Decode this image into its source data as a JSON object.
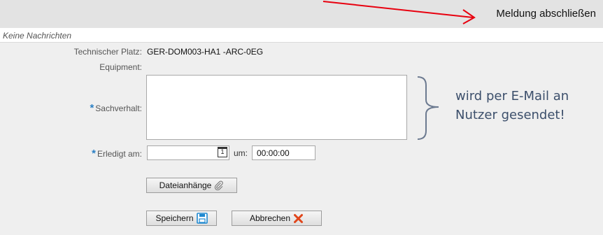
{
  "toolbar": {
    "action_label": "Meldung abschließen"
  },
  "messages": {
    "text": "Keine Nachrichten"
  },
  "form": {
    "tech_place_label": "Technischer Platz:",
    "tech_place_value": "GER-DOM003-HA1 -ARC-0EG",
    "equipment_label": "Equipment:",
    "required_marker": "*",
    "sachverhalt_label": "Sachverhalt:",
    "sachverhalt_value": "",
    "erledigt_label": "Erledigt am:",
    "date_value": "",
    "calendar_day": "1",
    "um_label": "um:",
    "time_value": "00:00:00"
  },
  "buttons": {
    "attachments": "Dateianhänge",
    "save": "Speichern",
    "cancel": "Abbrechen"
  },
  "annotation": {
    "line1": "wird per E-Mail an",
    "line2": "Nutzer gesendet!"
  },
  "colors": {
    "arrow": "#e8000f",
    "required": "#2a7fc4",
    "note_text": "#3c4f6b",
    "cancel_icon": "#e0451a",
    "save_icon": "#1e88d0"
  }
}
